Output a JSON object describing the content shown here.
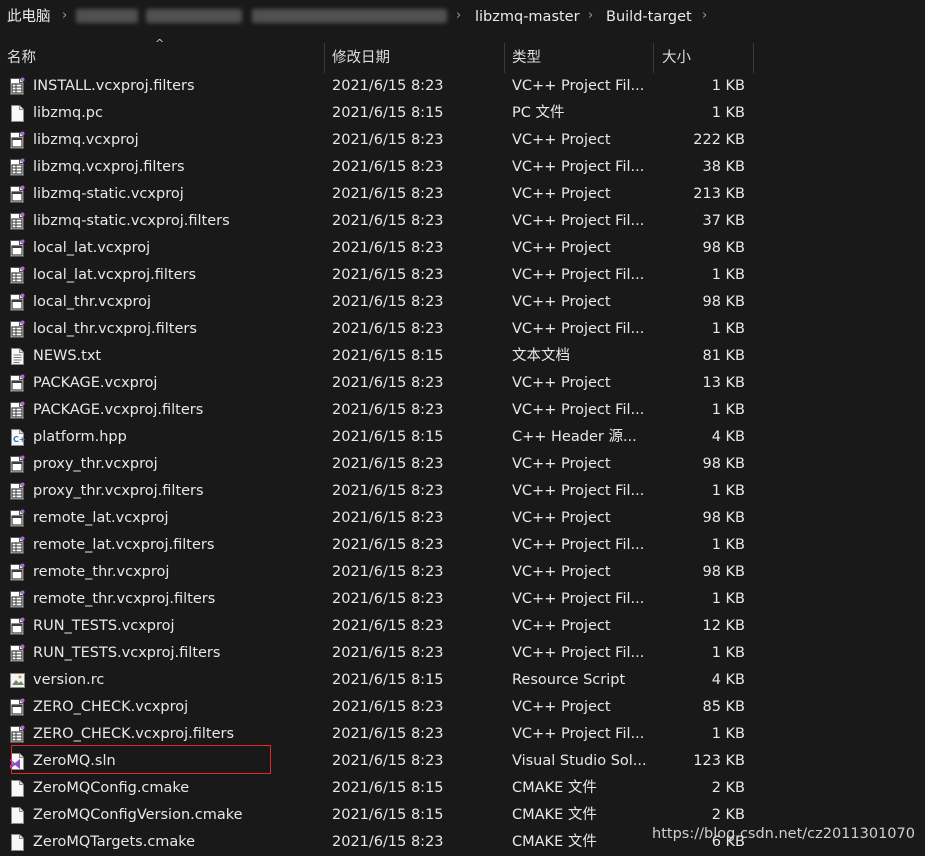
{
  "breadcrumb": {
    "root": "此电脑",
    "folder1": "libzmq-master",
    "folder2": "Build-target"
  },
  "columns": {
    "name": "名称",
    "date": "修改日期",
    "type": "类型",
    "size": "大小"
  },
  "files": [
    {
      "name": "INSTALL.vcxproj.filters",
      "date": "2021/6/15 8:23",
      "type": "VC++ Project Fil...",
      "size": "1 KB",
      "icon": "vcxproj-filters-icon"
    },
    {
      "name": "libzmq.pc",
      "date": "2021/6/15 8:15",
      "type": "PC 文件",
      "size": "1 KB",
      "icon": "file-icon"
    },
    {
      "name": "libzmq.vcxproj",
      "date": "2021/6/15 8:23",
      "type": "VC++ Project",
      "size": "222 KB",
      "icon": "vcxproj-icon"
    },
    {
      "name": "libzmq.vcxproj.filters",
      "date": "2021/6/15 8:23",
      "type": "VC++ Project Fil...",
      "size": "38 KB",
      "icon": "vcxproj-filters-icon"
    },
    {
      "name": "libzmq-static.vcxproj",
      "date": "2021/6/15 8:23",
      "type": "VC++ Project",
      "size": "213 KB",
      "icon": "vcxproj-icon"
    },
    {
      "name": "libzmq-static.vcxproj.filters",
      "date": "2021/6/15 8:23",
      "type": "VC++ Project Fil...",
      "size": "37 KB",
      "icon": "vcxproj-filters-icon"
    },
    {
      "name": "local_lat.vcxproj",
      "date": "2021/6/15 8:23",
      "type": "VC++ Project",
      "size": "98 KB",
      "icon": "vcxproj-icon"
    },
    {
      "name": "local_lat.vcxproj.filters",
      "date": "2021/6/15 8:23",
      "type": "VC++ Project Fil...",
      "size": "1 KB",
      "icon": "vcxproj-filters-icon"
    },
    {
      "name": "local_thr.vcxproj",
      "date": "2021/6/15 8:23",
      "type": "VC++ Project",
      "size": "98 KB",
      "icon": "vcxproj-icon"
    },
    {
      "name": "local_thr.vcxproj.filters",
      "date": "2021/6/15 8:23",
      "type": "VC++ Project Fil...",
      "size": "1 KB",
      "icon": "vcxproj-filters-icon"
    },
    {
      "name": "NEWS.txt",
      "date": "2021/6/15 8:15",
      "type": "文本文档",
      "size": "81 KB",
      "icon": "text-file-icon"
    },
    {
      "name": "PACKAGE.vcxproj",
      "date": "2021/6/15 8:23",
      "type": "VC++ Project",
      "size": "13 KB",
      "icon": "vcxproj-icon"
    },
    {
      "name": "PACKAGE.vcxproj.filters",
      "date": "2021/6/15 8:23",
      "type": "VC++ Project Fil...",
      "size": "1 KB",
      "icon": "vcxproj-filters-icon"
    },
    {
      "name": "platform.hpp",
      "date": "2021/6/15 8:15",
      "type": "C++ Header 源...",
      "size": "4 KB",
      "icon": "cpp-header-icon"
    },
    {
      "name": "proxy_thr.vcxproj",
      "date": "2021/6/15 8:23",
      "type": "VC++ Project",
      "size": "98 KB",
      "icon": "vcxproj-icon"
    },
    {
      "name": "proxy_thr.vcxproj.filters",
      "date": "2021/6/15 8:23",
      "type": "VC++ Project Fil...",
      "size": "1 KB",
      "icon": "vcxproj-filters-icon"
    },
    {
      "name": "remote_lat.vcxproj",
      "date": "2021/6/15 8:23",
      "type": "VC++ Project",
      "size": "98 KB",
      "icon": "vcxproj-icon"
    },
    {
      "name": "remote_lat.vcxproj.filters",
      "date": "2021/6/15 8:23",
      "type": "VC++ Project Fil...",
      "size": "1 KB",
      "icon": "vcxproj-filters-icon"
    },
    {
      "name": "remote_thr.vcxproj",
      "date": "2021/6/15 8:23",
      "type": "VC++ Project",
      "size": "98 KB",
      "icon": "vcxproj-icon"
    },
    {
      "name": "remote_thr.vcxproj.filters",
      "date": "2021/6/15 8:23",
      "type": "VC++ Project Fil...",
      "size": "1 KB",
      "icon": "vcxproj-filters-icon"
    },
    {
      "name": "RUN_TESTS.vcxproj",
      "date": "2021/6/15 8:23",
      "type": "VC++ Project",
      "size": "12 KB",
      "icon": "vcxproj-icon"
    },
    {
      "name": "RUN_TESTS.vcxproj.filters",
      "date": "2021/6/15 8:23",
      "type": "VC++ Project Fil...",
      "size": "1 KB",
      "icon": "vcxproj-filters-icon"
    },
    {
      "name": "version.rc",
      "date": "2021/6/15 8:15",
      "type": "Resource Script",
      "size": "4 KB",
      "icon": "resource-script-icon"
    },
    {
      "name": "ZERO_CHECK.vcxproj",
      "date": "2021/6/15 8:23",
      "type": "VC++ Project",
      "size": "85 KB",
      "icon": "vcxproj-icon"
    },
    {
      "name": "ZERO_CHECK.vcxproj.filters",
      "date": "2021/6/15 8:23",
      "type": "VC++ Project Fil...",
      "size": "1 KB",
      "icon": "vcxproj-filters-icon"
    },
    {
      "name": "ZeroMQ.sln",
      "date": "2021/6/15 8:23",
      "type": "Visual Studio Sol...",
      "size": "123 KB",
      "icon": "visual-studio-solution-icon"
    },
    {
      "name": "ZeroMQConfig.cmake",
      "date": "2021/6/15 8:15",
      "type": "CMAKE 文件",
      "size": "2 KB",
      "icon": "file-icon"
    },
    {
      "name": "ZeroMQConfigVersion.cmake",
      "date": "2021/6/15 8:15",
      "type": "CMAKE 文件",
      "size": "2 KB",
      "icon": "file-icon"
    },
    {
      "name": "ZeroMQTargets.cmake",
      "date": "2021/6/15 8:23",
      "type": "CMAKE 文件",
      "size": "6 KB",
      "icon": "file-icon"
    }
  ],
  "highlight_color": "#e0292b",
  "watermark": "https://blog.csdn.net/cz2011301070"
}
